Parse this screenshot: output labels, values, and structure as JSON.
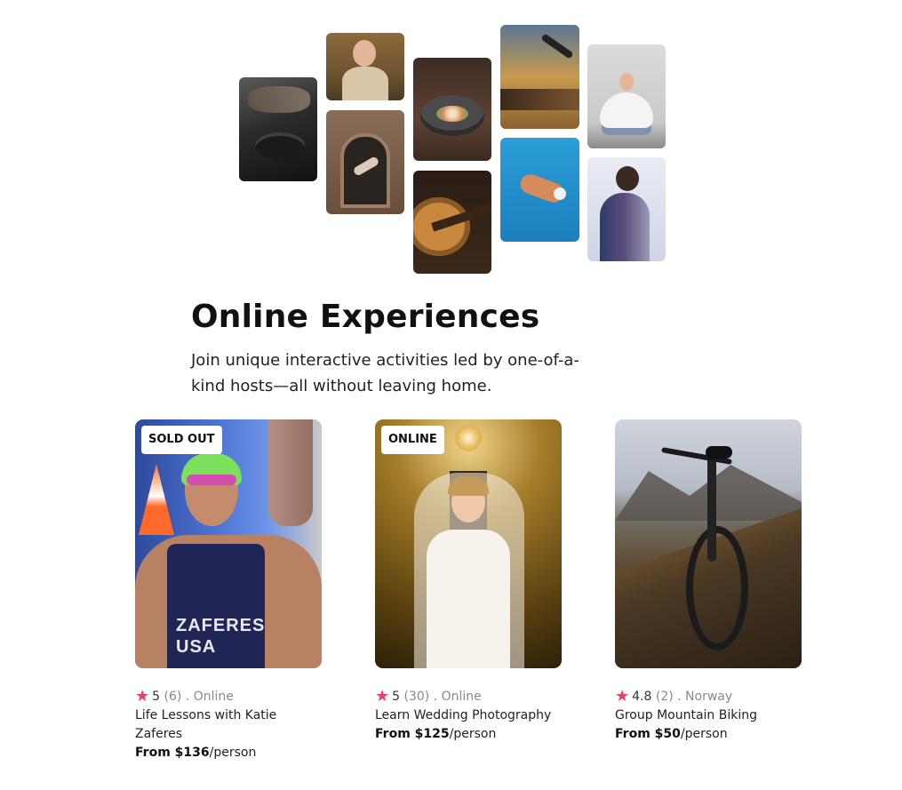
{
  "hero": {
    "tiles": [
      {
        "name": "cooking-photo"
      },
      {
        "name": "woman-portrait-photo"
      },
      {
        "name": "doorway-dancer-photo"
      },
      {
        "name": "food-bowl-photo"
      },
      {
        "name": "guitar-photo"
      },
      {
        "name": "microphone-photo"
      },
      {
        "name": "swimmer-pool-photo"
      },
      {
        "name": "yoga-photo"
      },
      {
        "name": "singer-photo"
      }
    ]
  },
  "section": {
    "title": "Online Experiences",
    "subtitle": "Join unique interactive activities led by one-of-a-kind hosts—all without leaving home."
  },
  "colors": {
    "star": "#fe395c",
    "muted_text": "#8a8a8a"
  },
  "cards": [
    {
      "badge": "SOLD OUT",
      "rating": "5",
      "review_count": "(6)",
      "location": ". Online",
      "title": "Life Lessons with Katie Zaferes",
      "price_prefix": "From $136",
      "price_suffix": "/person",
      "photo_text": "ZAFERES\nUSA"
    },
    {
      "badge": "ONLINE",
      "rating": "5",
      "review_count": "(30)",
      "location": ". Online",
      "title": "Learn Wedding Photography",
      "price_prefix": "From $125",
      "price_suffix": "/person"
    },
    {
      "badge": "",
      "rating": "4.8",
      "review_count": "(2)",
      "location": ". Norway",
      "title": "Group Mountain Biking",
      "price_prefix": "From $50",
      "price_suffix": "/person"
    }
  ]
}
